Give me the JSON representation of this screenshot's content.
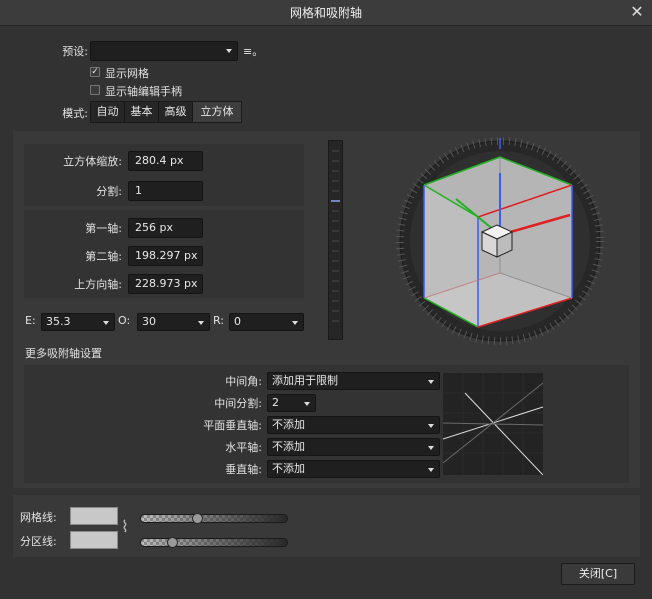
{
  "window": {
    "title": "网格和吸附轴",
    "close_glyph": "✕"
  },
  "preset": {
    "label": "预设:",
    "value": "",
    "menu_glyph": "≡。"
  },
  "options": {
    "show_grid": {
      "label": "显示网格",
      "checked": true,
      "check_glyph": "✓"
    },
    "show_axis_handles": {
      "label": "显示轴编辑手柄",
      "checked": false
    }
  },
  "mode": {
    "label": "模式:",
    "tabs": [
      "自动",
      "基本",
      "高级",
      "立方体"
    ],
    "selected": "立方体"
  },
  "cube": {
    "scale": {
      "label": "立方体缩放:",
      "value": "280.4 px"
    },
    "divisions": {
      "label": "分割:",
      "value": "1"
    },
    "axis1": {
      "label": "第一轴:",
      "value": "256 px"
    },
    "axis2": {
      "label": "第二轴:",
      "value": "198.297 px"
    },
    "up_axis": {
      "label": "上方向轴:",
      "value": "228.973 px"
    },
    "e": {
      "label": "E:",
      "value": "35.3"
    },
    "o": {
      "label": "O:",
      "value": "30"
    },
    "r": {
      "label": "R:",
      "value": "0"
    }
  },
  "more_snap": {
    "heading": "更多吸附轴设置",
    "mid_angle": {
      "label": "中间角:",
      "value": "添加用于限制"
    },
    "mid_divisions": {
      "label": "中间分割:",
      "value": "2"
    },
    "plane_vertical": {
      "label": "平面垂直轴:",
      "value": "不添加"
    },
    "horizontal": {
      "label": "水平轴:",
      "value": "不添加"
    },
    "vertical": {
      "label": "垂直轴:",
      "value": "不添加"
    }
  },
  "appearance": {
    "grid_lines": {
      "label": "网格线:",
      "slider_value": 0.38
    },
    "division_lines": {
      "label": "分区线:",
      "slider_value": 0.2
    },
    "link_glyph": "⌇",
    "colors": {
      "swatch": "#c8c8c8",
      "axis_red": "#e02020",
      "axis_green": "#20b020",
      "axis_blue": "#3a5cff"
    }
  },
  "footer": {
    "close_button": "关闭[C]"
  }
}
